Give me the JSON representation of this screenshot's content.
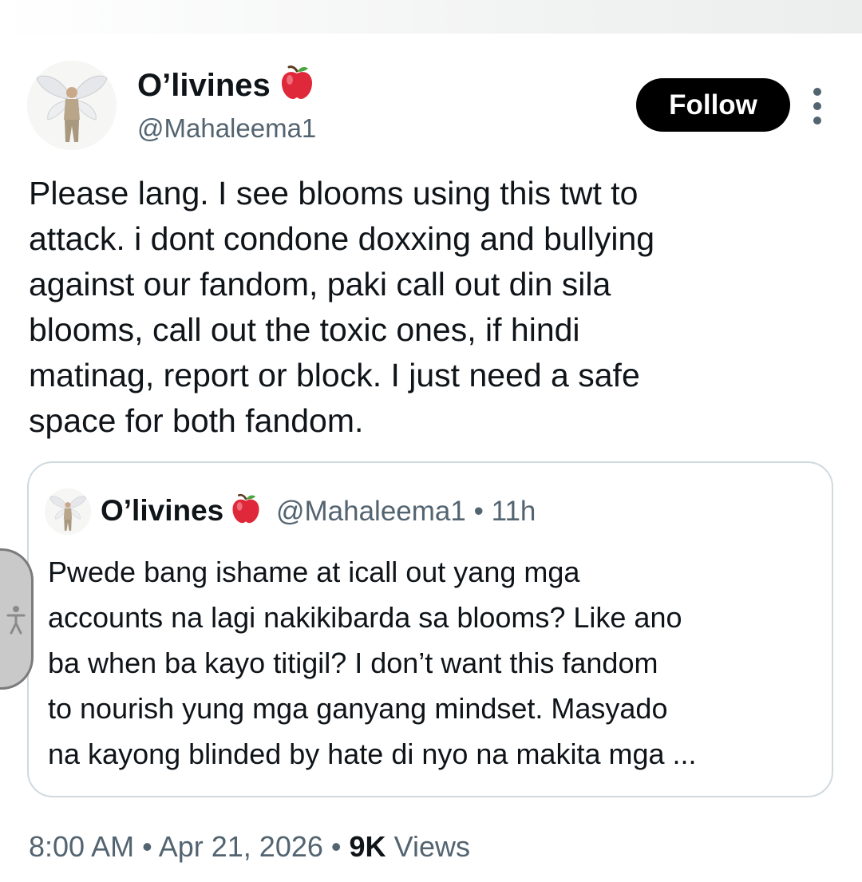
{
  "author": {
    "display_name": "O’livines",
    "handle": "@Mahaleema1",
    "name_emoji": "red-apple-icon"
  },
  "actions": {
    "follow_label": "Follow",
    "more_icon": "more-vertical-icon"
  },
  "tweet": {
    "text": "Please lang. I see blooms using this twt to\nattack. i dont condone doxxing and bullying\nagainst our fandom, paki call out din sila\nblooms,  call out the toxic ones, if hindi\nmatinag, report or block. I just need a safe\nspace for both fandom."
  },
  "quoted_tweet": {
    "display_name": "O’livines",
    "handle": "@Mahaleema1",
    "separator": "•",
    "time": "11h",
    "text": "Pwede bang ishame at icall out yang mga\naccounts na lagi nakikibarda sa blooms? Like ano\nba when ba kayo titigil? I don’t want this fandom\nto nourish yung mga ganyang mindset. Masyado\nna kayong blinded by hate di nyo na makita mga ..."
  },
  "meta": {
    "time": "8:00 AM",
    "separator": "•",
    "date": "Apr 21, 2026",
    "views_count": "9K",
    "views_label": "Views"
  },
  "colors": {
    "text_primary": "#0f1419",
    "text_secondary": "#536471",
    "border": "#cfd9de",
    "follow_bg": "#000000",
    "apple_red": "#e0283b"
  }
}
